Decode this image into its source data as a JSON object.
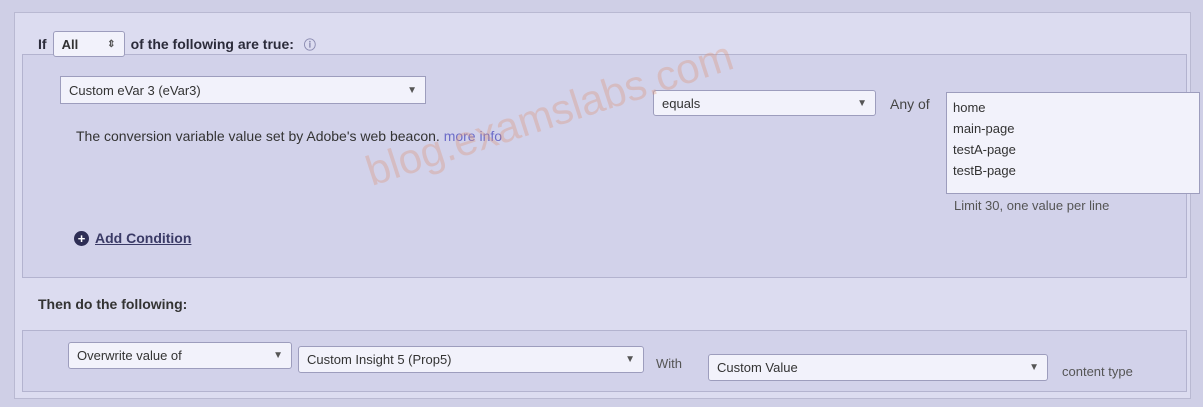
{
  "rule": {
    "if_prefix": "If",
    "match_select": "All",
    "if_suffix": "of the following are true:"
  },
  "condition": {
    "variable": "Custom eVar 3 (eVar3)",
    "description": "The conversion variable value set by Adobe's web beacon.",
    "more_info": "more info",
    "operator": "equals",
    "any_of_label": "Any of",
    "values": [
      "home",
      "main-page",
      "testA-page",
      "testB-page"
    ],
    "limit_note": "Limit 30, one value per line",
    "add_condition": "Add Condition"
  },
  "actions": {
    "title": "Then do the following:",
    "action": "Overwrite value of",
    "target": "Custom Insight 5 (Prop5)",
    "with_label": "With",
    "value_source": "Custom Value",
    "content_type": "content type"
  },
  "watermark": "blog.examslabs.com"
}
